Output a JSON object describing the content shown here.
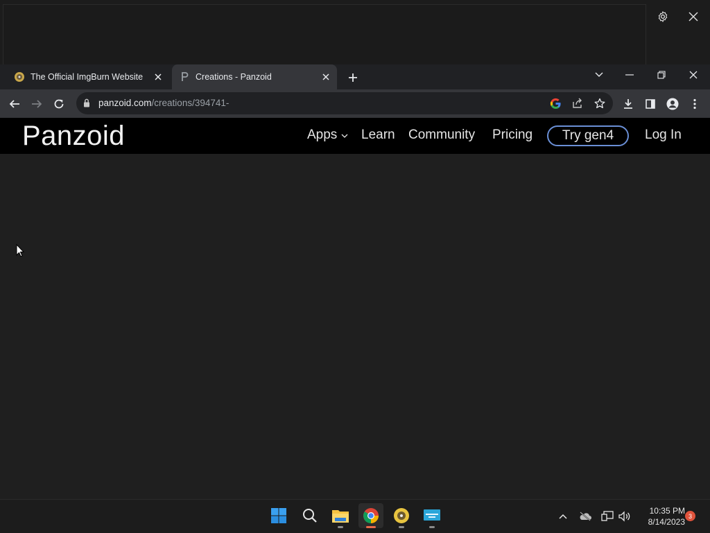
{
  "tabs": [
    {
      "title": "The Official ImgBurn Website",
      "favicon": "imgburn-disc-icon",
      "active": false
    },
    {
      "title": "Creations - Panzoid",
      "favicon": "panzoid-p-icon",
      "active": true
    }
  ],
  "address": {
    "host": "panzoid.com",
    "path": "/creations/394741-"
  },
  "site": {
    "logo": "Panzoid",
    "nav": {
      "apps": "Apps",
      "learn": "Learn",
      "community": "Community",
      "pricing": "Pricing",
      "try": "Try gen4",
      "login": "Log In"
    }
  },
  "taskbar": {
    "apps": [
      "start-icon",
      "search-icon",
      "file-explorer-icon",
      "chrome-icon",
      "imgburn-icon",
      "remote-desktop-icon"
    ],
    "time": "10:35 PM",
    "date": "8/14/2023",
    "notifications": "3"
  },
  "colors": {
    "accent": "#6a8fd6",
    "notification": "#e0533c"
  }
}
